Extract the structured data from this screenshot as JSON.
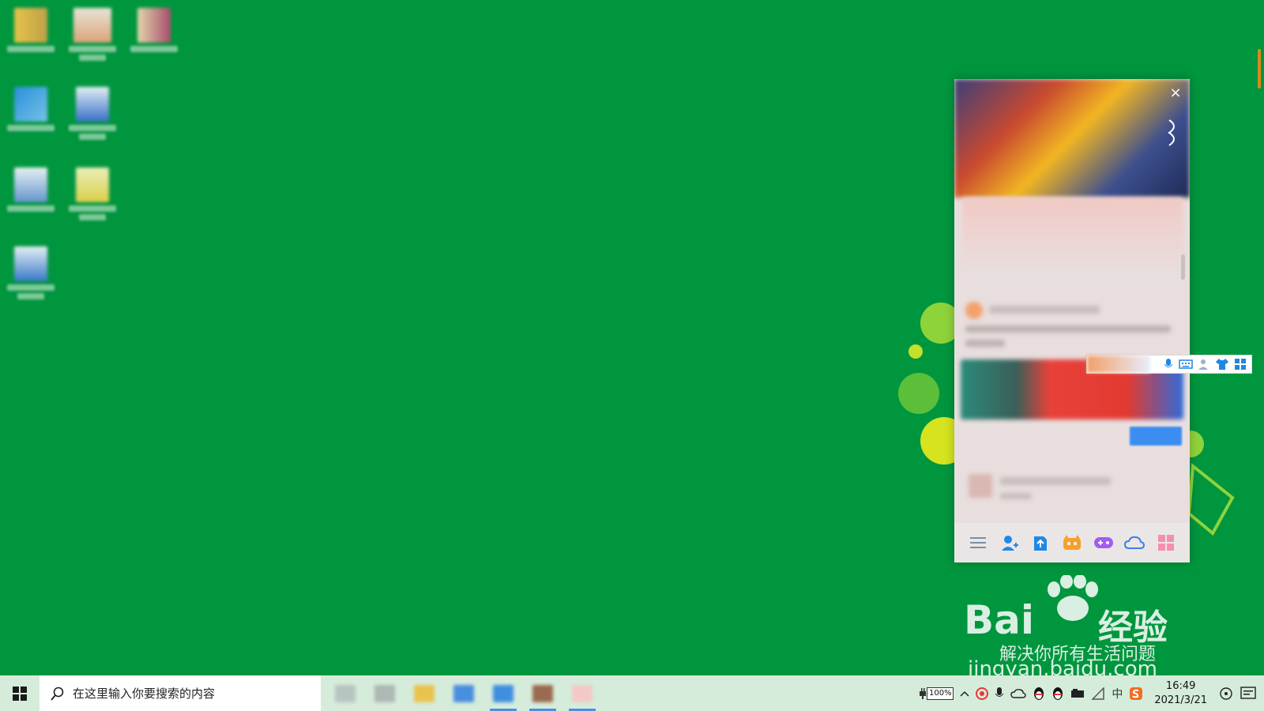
{
  "taskbar": {
    "search_placeholder": "在这里输入你要搜索的内容",
    "battery_percent": "100%",
    "ime_indicator": "中",
    "time": "16:49",
    "date": "2021/3/21"
  },
  "watermark": {
    "brand_left": "Bai",
    "brand_right": "经验",
    "slogan": "解决你所有生活问题",
    "url": "jingyan.baidu.com"
  },
  "qq_panel": {
    "close_label": "×"
  },
  "colors": {
    "desktop_bg": "#00963e",
    "taskbar_bg": "#d6ecdb",
    "accent_blue": "#1e88e5"
  }
}
